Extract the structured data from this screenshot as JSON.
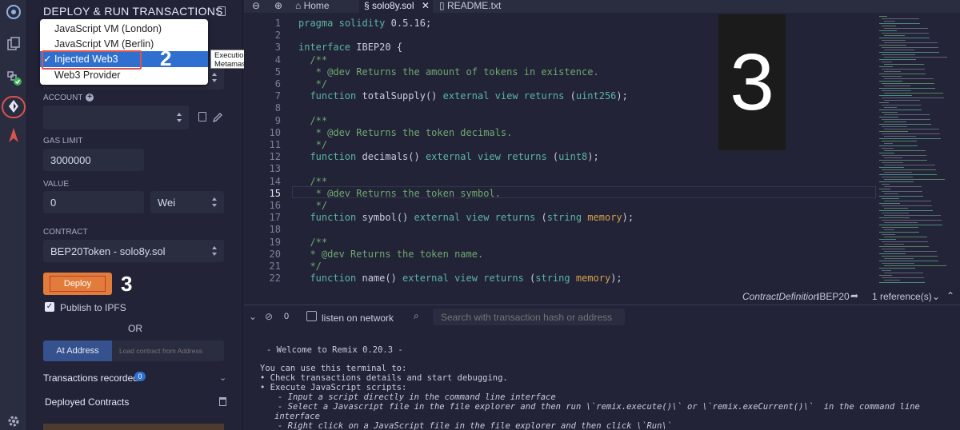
{
  "rail": {
    "icons": [
      "remix-logo-icon",
      "file-explorer-icon",
      "solidity-compiler-icon",
      "deploy-run-icon",
      "debugger-icon",
      "settings-icon"
    ]
  },
  "panel": {
    "title": "DEPLOY & RUN TRANSACTIONS",
    "environment_options": [
      "JavaScript VM (London)",
      "JavaScript VM (Berlin)",
      "Injected Web3",
      "Web3 Provider"
    ],
    "environment_selected": "Injected Web3",
    "env_tooltip": "Execution environment has been provided by Metamask or similar provider.",
    "step2_label": "2",
    "account_label": "ACCOUNT",
    "account_value": "",
    "gas_limit_label": "GAS LIMIT",
    "gas_limit_value": "3000000",
    "value_label": "VALUE",
    "value_amount": "0",
    "value_unit": "Wei",
    "contract_label": "CONTRACT",
    "contract_value": "BEP20Token - solo8y.sol",
    "deploy_label": "Deploy",
    "step3_label": "3",
    "publish_ipfs_label": "Publish to IPFS",
    "publish_ipfs_checked": true,
    "or_label": "OR",
    "at_address_label": "At Address",
    "load_contract_placeholder": "Load contract from Address",
    "transactions_recorded_label": "Transactions recorded",
    "transactions_recorded_count": "0",
    "deployed_contracts_label": "Deployed Contracts"
  },
  "tabs": [
    {
      "label": "Home"
    },
    {
      "label": "solo8y.sol",
      "active": true
    },
    {
      "label": "README.txt"
    }
  ],
  "editor": {
    "lines": [
      {
        "n": "1",
        "text": "pragma solidity 0.5.16;"
      },
      {
        "n": "2",
        "text": ""
      },
      {
        "n": "3",
        "text": "interface IBEP20 {"
      },
      {
        "n": "4",
        "text": "  /**"
      },
      {
        "n": "5",
        "text": "   * @dev Returns the amount of tokens in existence."
      },
      {
        "n": "6",
        "text": "   */"
      },
      {
        "n": "7",
        "text": "  function totalSupply() external view returns (uint256);"
      },
      {
        "n": "8",
        "text": ""
      },
      {
        "n": "9",
        "text": "  /**"
      },
      {
        "n": "10",
        "text": "   * @dev Returns the token decimals."
      },
      {
        "n": "11",
        "text": "   */"
      },
      {
        "n": "12",
        "text": "  function decimals() external view returns (uint8);"
      },
      {
        "n": "13",
        "text": ""
      },
      {
        "n": "14",
        "text": "  /**"
      },
      {
        "n": "15",
        "text": "   * @dev Returns the token symbol."
      },
      {
        "n": "16",
        "text": "   */"
      },
      {
        "n": "17",
        "text": "  function symbol() external view returns (string memory);"
      },
      {
        "n": "18",
        "text": ""
      },
      {
        "n": "19",
        "text": "  /**"
      },
      {
        "n": "20",
        "text": "  * @dev Returns the token name."
      },
      {
        "n": "21",
        "text": "  */"
      },
      {
        "n": "22",
        "text": "  function name() external view returns (string memory);"
      }
    ],
    "overlay_number": "3"
  },
  "statusline": {
    "contract_definition": "ContractDefinition",
    "contract_name": "IBEP20",
    "references": "1 reference(s)"
  },
  "terminal": {
    "counter": "0",
    "listen_label": "listen on network",
    "search_placeholder": "Search with transaction hash or address",
    "lines": [
      "- Welcome to Remix 0.20.3 -",
      "You can use this terminal to:",
      "• Check transactions details and start debugging.",
      "• Execute JavaScript scripts:",
      "- Input a script directly in the command line interface",
      "- Select a Javascript file in the file explorer and then run \\`remix.execute()\\` or \\`remix.exeCurrent()\\`  in the command line",
      "interface",
      "- Right click on a JavaScript file in the file explorer and then click \\`Run\\`"
    ]
  },
  "colors": {
    "accent_blue": "#2f6fcf",
    "deploy_orange": "#e17c3b",
    "annotation_red": "#d9534f",
    "badge_blue": "#2f6fcf"
  }
}
